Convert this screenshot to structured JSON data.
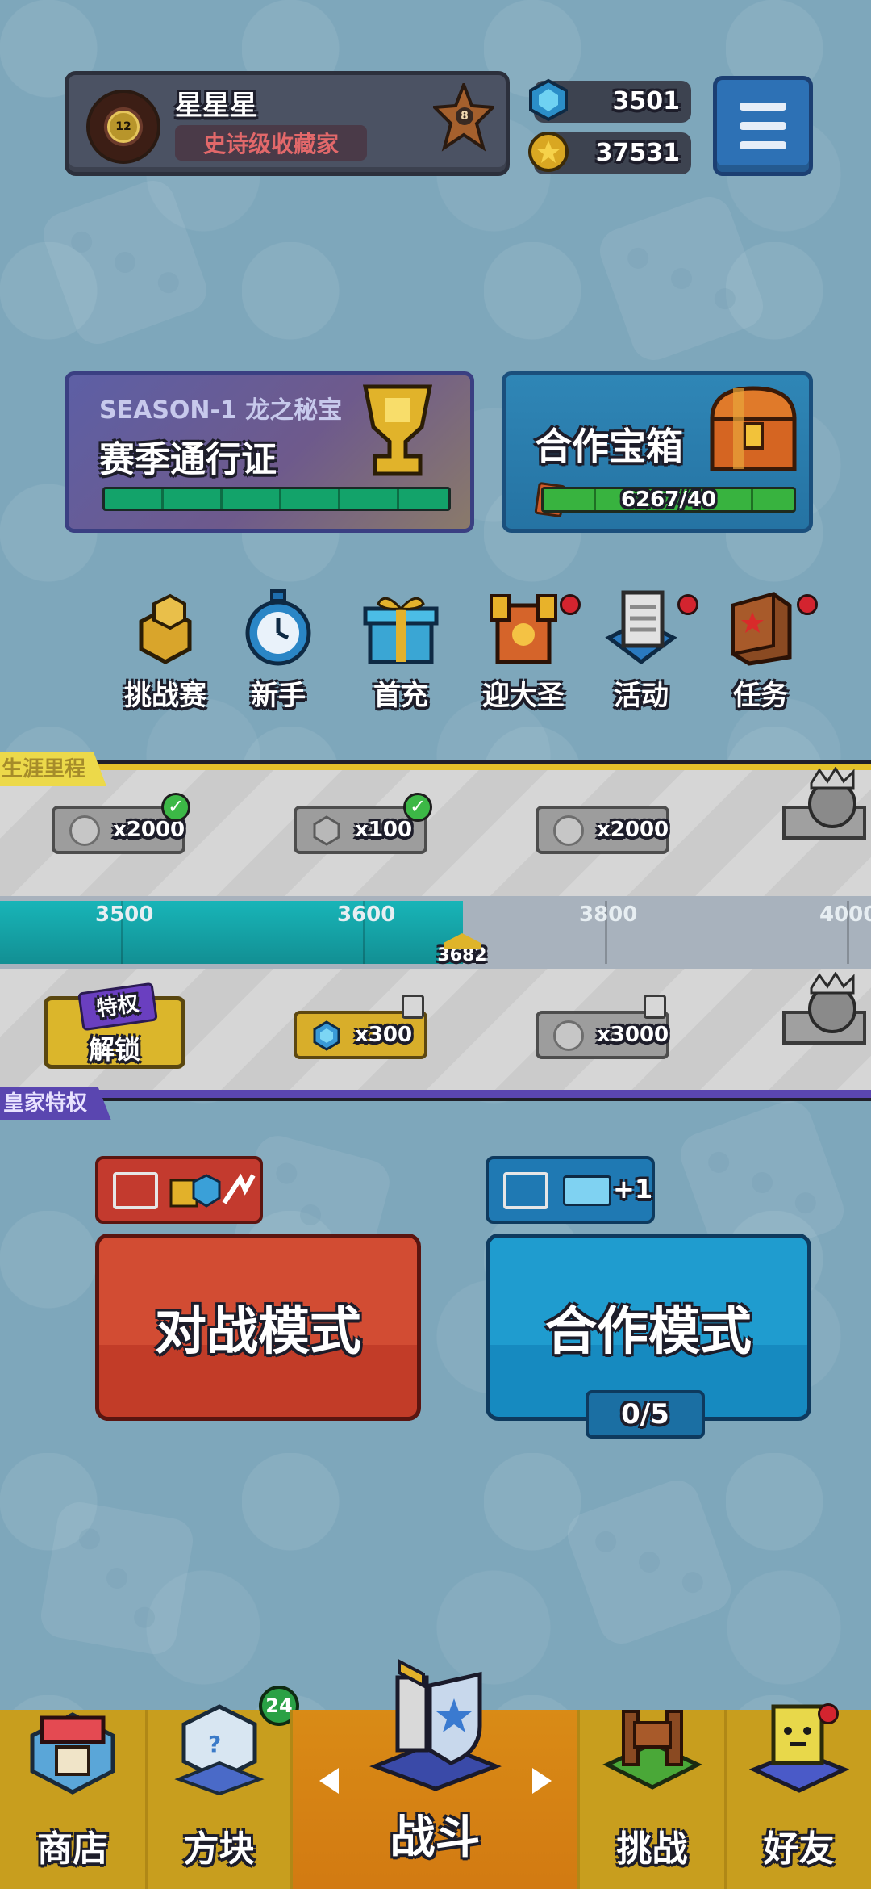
{
  "profile": {
    "name": "星星星",
    "title": "史诗级收藏家",
    "avatar_level": "12",
    "rank_level": "8"
  },
  "currencies": {
    "gems": "3501",
    "coins": "37531"
  },
  "menu_icon": "hamburger-icon",
  "season_pass": {
    "subtitle": "SEASON-1 龙之秘宝",
    "title": "赛季通行证",
    "progress": 1.0
  },
  "coop_chest": {
    "title": "合作宝箱",
    "progress_text": "6267/40",
    "progress": 1.0
  },
  "features": [
    {
      "label": "挑战赛",
      "icon": "challenge-blocks-icon",
      "dot": false
    },
    {
      "label": "新手",
      "icon": "stopwatch-icon",
      "dot": false
    },
    {
      "label": "首充",
      "icon": "gift-box-icon",
      "dot": false
    },
    {
      "label": "迎大圣",
      "icon": "monkey-king-icon",
      "dot": true
    },
    {
      "label": "活动",
      "icon": "event-scroll-icon",
      "dot": true
    },
    {
      "label": "任务",
      "icon": "quest-book-icon",
      "dot": true
    }
  ],
  "career": {
    "label": "生涯里程",
    "free_rewards": [
      {
        "amount": "x2000",
        "icon": "coin-icon",
        "claimed": true
      },
      {
        "amount": "x100",
        "icon": "gem-icon",
        "claimed": true
      },
      {
        "amount": "x2000",
        "icon": "coin-icon",
        "claimed": false
      }
    ],
    "ticks": [
      "3500",
      "3600",
      "3800",
      "4000"
    ],
    "current": "3682",
    "royal_label": "皇家特权",
    "unlock_tag": "特权",
    "unlock_label": "解锁",
    "royal_rewards": [
      {
        "amount": "x300",
        "icon": "gem-icon",
        "locked": true
      },
      {
        "amount": "x3000",
        "icon": "coin-icon",
        "locked": true
      }
    ]
  },
  "modes": {
    "battle": {
      "label": "对战模式",
      "tag_icon": "video-reward-icon"
    },
    "coop": {
      "label": "合作模式",
      "tag_icon": "video-reward-icon",
      "tag_text": "+1",
      "count": "0/5"
    }
  },
  "nav": {
    "shop": "商店",
    "blocks": "方块",
    "blocks_badge": "24",
    "battle": "战斗",
    "challenge": "挑战",
    "friends": "好友"
  },
  "colors": {
    "battle": "#d24c33",
    "coop": "#1f9ccf",
    "nav": "#c89e1e",
    "nav_active": "#d98b16"
  }
}
